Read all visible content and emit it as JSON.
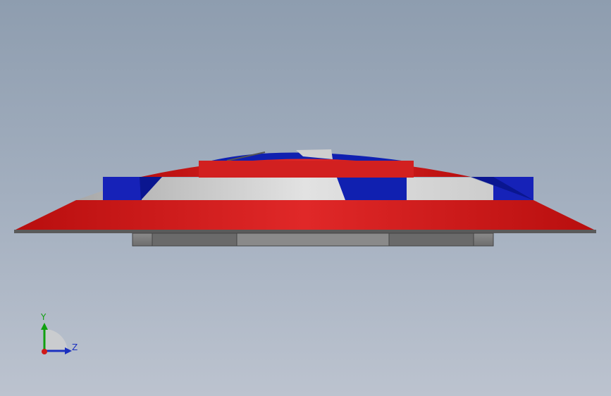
{
  "viewport": {
    "background_top": "#8e9daf",
    "background_bottom": "#bcc3cf"
  },
  "model": {
    "name": "shield",
    "view": "side",
    "colors": {
      "red": "#d01818",
      "blue": "#1020b0",
      "white": "#d8d8d8",
      "base": "#808080"
    }
  },
  "triad": {
    "y_label": "Y",
    "z_label": "Z",
    "y_color": "#10a010",
    "z_color": "#1a2fbf",
    "x_color": "#d01818"
  }
}
